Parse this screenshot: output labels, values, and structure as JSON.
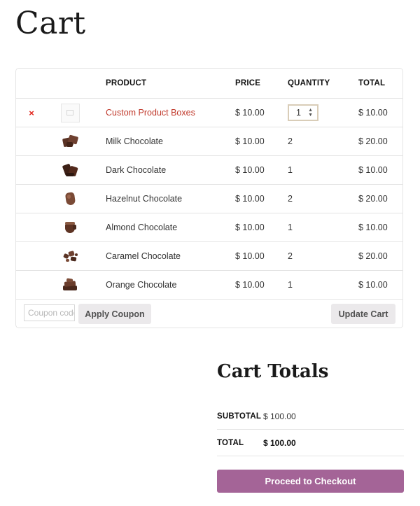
{
  "page": {
    "title": "Cart"
  },
  "table": {
    "headers": {
      "product": "PRODUCT",
      "price": "PRICE",
      "quantity": "QUANTITY",
      "total": "TOTAL"
    },
    "rows": [
      {
        "name": "Custom Product Boxes",
        "price": "$ 10.00",
        "quantity": "1",
        "total": "$ 10.00",
        "remove": "×",
        "thumbnail": "box-placeholder-icon",
        "editable": true
      },
      {
        "name": "Milk Chocolate",
        "price": "$ 10.00",
        "quantity": "2",
        "total": "$ 20.00",
        "thumbnail": "chocolate-pieces"
      },
      {
        "name": "Dark Chocolate",
        "price": "$ 10.00",
        "quantity": "1",
        "total": "$ 10.00",
        "thumbnail": "chocolate-pieces"
      },
      {
        "name": "Hazelnut Chocolate",
        "price": "$ 10.00",
        "quantity": "2",
        "total": "$ 20.00",
        "thumbnail": "chocolate-heart"
      },
      {
        "name": "Almond Chocolate",
        "price": "$ 10.00",
        "quantity": "1",
        "total": "$ 10.00",
        "thumbnail": "chocolate-cup"
      },
      {
        "name": "Caramel Chocolate",
        "price": "$ 10.00",
        "quantity": "2",
        "total": "$ 20.00",
        "thumbnail": "chocolate-crumbs"
      },
      {
        "name": "Orange Chocolate",
        "price": "$ 10.00",
        "quantity": "1",
        "total": "$ 10.00",
        "thumbnail": "chocolate-stack"
      }
    ]
  },
  "actions": {
    "coupon_placeholder": "Coupon code",
    "apply_coupon": "Apply Coupon",
    "update_cart": "Update Cart"
  },
  "totals": {
    "title": "Cart Totals",
    "subtotal_label": "SUBTOTAL",
    "subtotal_value": "$ 100.00",
    "total_label": "TOTAL",
    "total_value": "$ 100.00",
    "checkout": "Proceed to Checkout"
  },
  "colors": {
    "accent_link": "#c0392b",
    "remove": "#e2231a",
    "checkout_button": "#a46497",
    "grey_button": "#ebe9eb",
    "chocolate": "#5a3325"
  }
}
